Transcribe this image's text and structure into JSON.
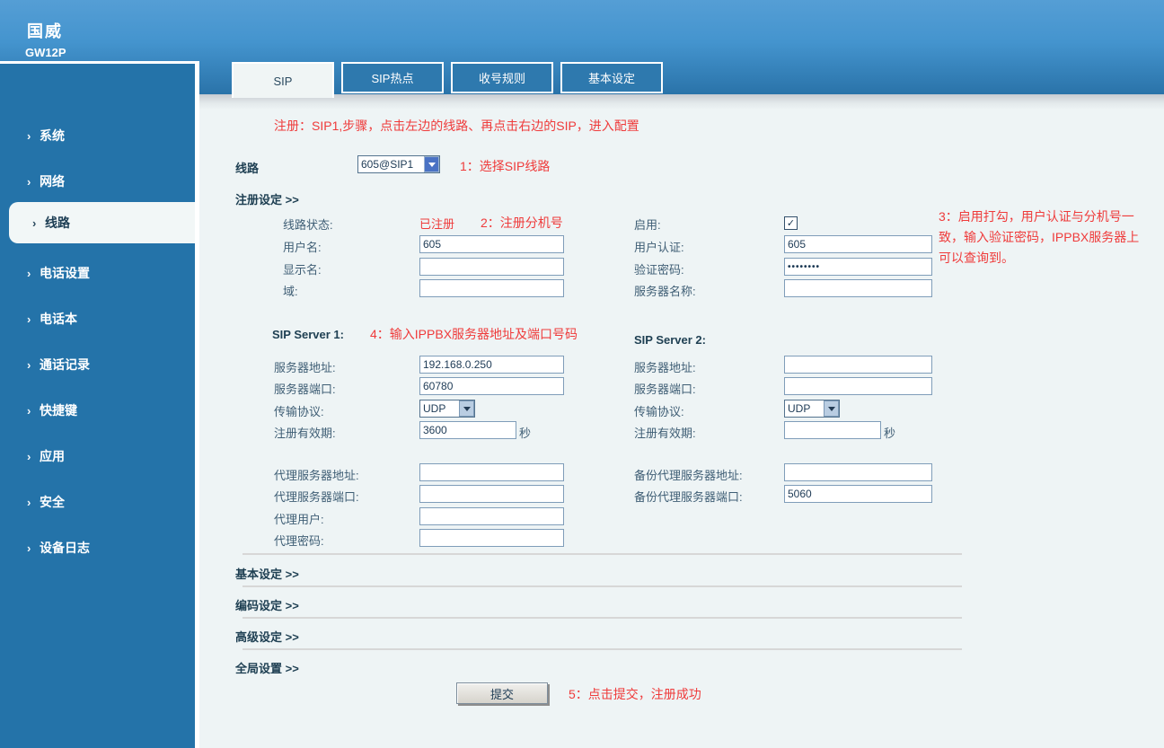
{
  "brand": {
    "logo": "国威",
    "model": "GW12P"
  },
  "tabs": [
    {
      "label": "SIP"
    },
    {
      "label": "SIP热点"
    },
    {
      "label": "收号规则"
    },
    {
      "label": "基本设定"
    }
  ],
  "sidebar": {
    "arrow": "›",
    "items": [
      {
        "label": "系统"
      },
      {
        "label": "网络"
      },
      {
        "label": "线路"
      },
      {
        "label": "电话设置"
      },
      {
        "label": "电话本"
      },
      {
        "label": "通话记录"
      },
      {
        "label": "快捷键"
      },
      {
        "label": "应用"
      },
      {
        "label": "安全"
      },
      {
        "label": "设备日志"
      }
    ]
  },
  "annotations": {
    "top": "注册：SIP1,步骤，点击左边的线路、再点击右边的SIP，进入配置",
    "step1": "1：选择SIP线路",
    "step2": "2：注册分机号",
    "step3_line1": "3：启用打勾，用户认证与分机号一",
    "step3_line2": "致，输入验证密码，IPPBX服务器上",
    "step3_line3": "可以查询到。",
    "step4": "4：输入IPPBX服务器地址及端口号码",
    "step5": "5：点击提交，注册成功"
  },
  "form": {
    "line_label": "线路",
    "line_value": "605@SIP1",
    "section_register": "注册设定 >>",
    "fields": {
      "line_status_label": "线路状态:",
      "line_status_value": "已注册",
      "username_label": "用户名:",
      "username_value": "605",
      "display_name_label": "显示名:",
      "display_name_value": "",
      "domain_label": "域:",
      "domain_value": "",
      "enable_label": "启用:",
      "enable_check_glyph": "✓",
      "auth_user_label": "用户认证:",
      "auth_user_value": "605",
      "auth_password_label": "验证密码:",
      "auth_password_value": "••••••••",
      "server_name_label": "服务器名称:",
      "server_name_value": ""
    },
    "sip_server1_title": "SIP Server 1:",
    "sip_server2_title": "SIP Server 2:",
    "server1": {
      "addr_label": "服务器地址:",
      "addr": "192.168.0.250",
      "port_label": "服务器端口:",
      "port": "60780",
      "proto_label": "传输协议:",
      "proto": "UDP",
      "expire_label": "注册有效期:",
      "expire": "3600",
      "expire_unit": "秒"
    },
    "server2": {
      "addr_label": "服务器地址:",
      "addr": "",
      "port_label": "服务器端口:",
      "port": "",
      "proto_label": "传输协议:",
      "proto": "UDP",
      "expire_label": "注册有效期:",
      "expire": "",
      "expire_unit": "秒"
    },
    "proxy": {
      "addr_label": "代理服务器地址:",
      "addr": "",
      "port_label": "代理服务器端口:",
      "port": "",
      "user_label": "代理用户:",
      "user": "",
      "pwd_label": "代理密码:",
      "pwd": "",
      "backup_addr_label": "备份代理服务器地址:",
      "backup_addr": "",
      "backup_port_label": "备份代理服务器端口:",
      "backup_port": "5060"
    },
    "sections": {
      "basic": "基本设定 >>",
      "codec": "编码设定 >>",
      "advanced": "高级设定 >>",
      "global": "全局设置 >>"
    },
    "submit_label": "提交"
  }
}
